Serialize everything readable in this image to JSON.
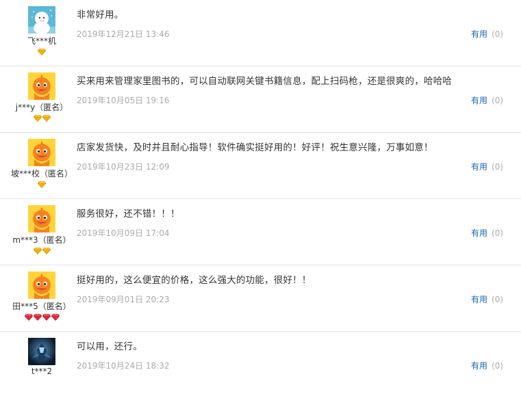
{
  "colors": {
    "text": "#333333",
    "muted": "#aaaaaa",
    "link": "#1a66b3",
    "divider": "#e3e3e3",
    "diamond_gold": "#f5b400",
    "diamond_red": "#e8283c"
  },
  "reviews": [
    {
      "user": "飞***机",
      "avatar": "snow-character-avatar",
      "badge_type": "gold",
      "badge_count": 1,
      "content": "非常好用。",
      "date": "2019年12月21日 13:46",
      "useful_label": "有用",
      "useful_count": "(0)"
    },
    {
      "user": "j***y（匿名）",
      "avatar": "orange-mascot-avatar",
      "badge_type": "gold",
      "badge_count": 2,
      "content": "买来用来管理家里图书的，可以自动联网关键书籍信息，配上扫码枪，还是很爽的，哈哈哈",
      "date": "2019年10月05日 19:16",
      "useful_label": "有用",
      "useful_count": "(0)"
    },
    {
      "user": "坡***校（匿名）",
      "avatar": "orange-mascot-avatar",
      "badge_type": "gold",
      "badge_count": 1,
      "content": "店家发货快，及时并且耐心指导！软件确实挺好用的！好评！祝生意兴隆，万事如意！",
      "date": "2019年10月23日 12:09",
      "useful_label": "有用",
      "useful_count": "(0)"
    },
    {
      "user": "m***3（匿名）",
      "avatar": "orange-mascot-avatar",
      "badge_type": "gold",
      "badge_count": 2,
      "content": "服务很好，还不错！！！",
      "date": "2019年10月09日 17:04",
      "useful_label": "有用",
      "useful_count": "(0)"
    },
    {
      "user": "田***5（匿名）",
      "avatar": "orange-mascot-avatar",
      "badge_type": "red",
      "badge_count": 4,
      "content": "挺好用的，这么便宜的价格，这么强大的功能，很好！！",
      "date": "2019年09月01日 20:23",
      "useful_label": "有用",
      "useful_count": "(0)"
    },
    {
      "user": "t***2",
      "avatar": "game-character-avatar",
      "badge_type": "none",
      "badge_count": 0,
      "content": "可以用，还行。",
      "date": "2019年10月24日 18:32",
      "useful_label": "有用",
      "useful_count": "(0)"
    }
  ]
}
